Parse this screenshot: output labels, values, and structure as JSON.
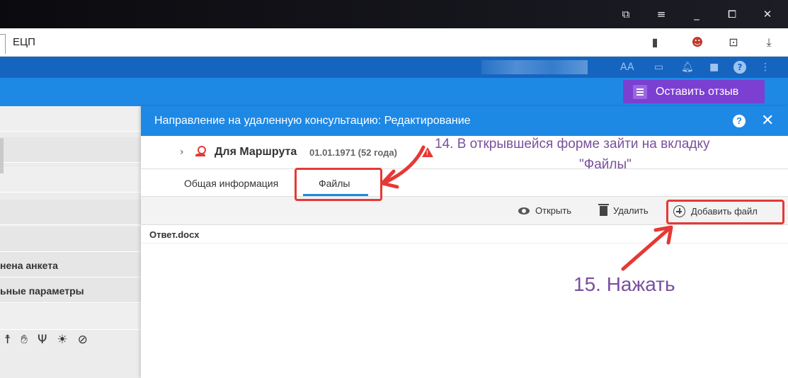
{
  "browser": {
    "tab_title": "ЕЦП"
  },
  "app": {
    "font_size_label": "AA",
    "feedback_button": "Оставить отзыв"
  },
  "left_panel": {
    "item1": "нена анкета",
    "item2": "ьные параметры"
  },
  "modal": {
    "title": "Направление на удаленную консультацию: Редактирование",
    "help": "?",
    "close": "✕",
    "patient": {
      "name": "Для Маршрута",
      "birth": "01.01.1971 (52 года)"
    },
    "tabs": [
      {
        "label": "Общая информация"
      },
      {
        "label": "Файлы",
        "active": true
      }
    ],
    "toolbar": {
      "open": "Открыть",
      "delete": "Удалить",
      "add_file": "Добавить файл"
    },
    "files": [
      {
        "name": "Ответ.docx"
      }
    ]
  },
  "annotations": {
    "step14_line1": "14. В открывшейся форме зайти на вкладку",
    "step14_line2": "\"Файлы\"",
    "step15": "15. Нажать",
    "color": "#e53935",
    "text_color": "#7a4f9c"
  }
}
